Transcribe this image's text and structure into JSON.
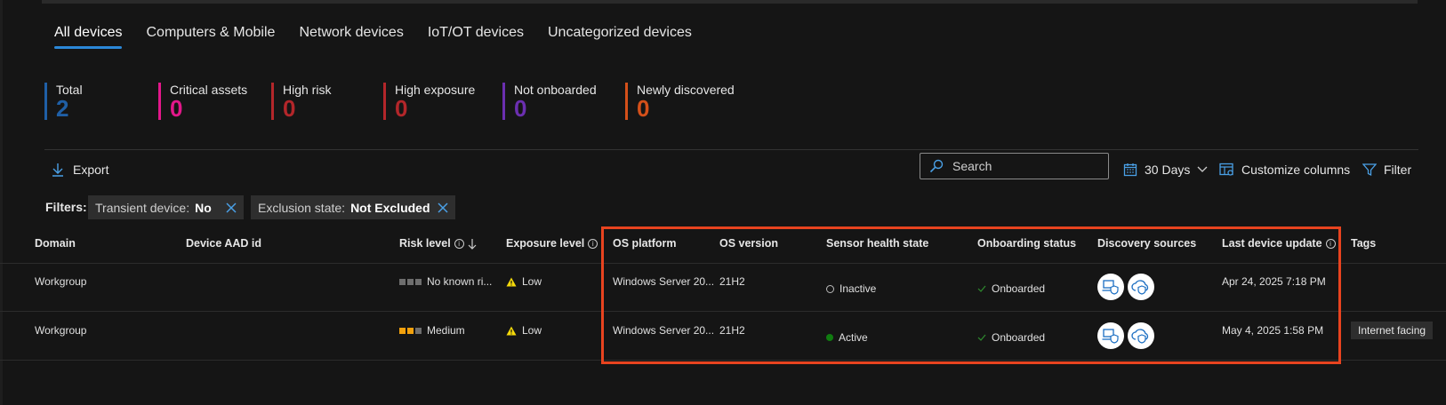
{
  "tabs": [
    "All devices",
    "Computers & Mobile",
    "Network devices",
    "IoT/OT devices",
    "Uncategorized devices"
  ],
  "stats": [
    {
      "label": "Total",
      "value": "2",
      "color": "#1f5fa6"
    },
    {
      "label": "Critical assets",
      "value": "0",
      "color": "#e3178a"
    },
    {
      "label": "High risk",
      "value": "0",
      "color": "#b3262a"
    },
    {
      "label": "High exposure",
      "value": "0",
      "color": "#b3262a"
    },
    {
      "label": "Not onboarded",
      "value": "0",
      "color": "#6b2fb0"
    },
    {
      "label": "Newly discovered",
      "value": "0",
      "color": "#d4501a"
    }
  ],
  "toolbar": {
    "export_label": "Export",
    "search_placeholder": "Search",
    "days_label": "30 Days",
    "customize_label": "Customize columns",
    "filter_label": "Filter"
  },
  "filters": {
    "label": "Filters:",
    "chips": [
      {
        "key": "Transient device:",
        "value": "No"
      },
      {
        "key": "Exclusion state:",
        "value": "Not Excluded"
      }
    ]
  },
  "columns": {
    "domain": "Domain",
    "aad": "Device AAD id",
    "risk": "Risk level",
    "exposure": "Exposure level",
    "os_platform": "OS platform",
    "os_version": "OS version",
    "sensor": "Sensor health state",
    "onboarding": "Onboarding status",
    "discovery": "Discovery sources",
    "last_update": "Last device update",
    "tags": "Tags"
  },
  "rows": [
    {
      "domain": "Workgroup",
      "aad": "",
      "risk": "No known ri...",
      "risk_level": 0,
      "exposure": "Low",
      "os_platform": "Windows Server 20...",
      "os_version": "21H2",
      "sensor": "Inactive",
      "onboarding": "Onboarded",
      "last_update": "Apr 24, 2025 7:18 PM",
      "tag": ""
    },
    {
      "domain": "Workgroup",
      "aad": "",
      "risk": "Medium",
      "risk_level": 2,
      "exposure": "Low",
      "os_platform": "Windows Server 20...",
      "os_version": "21H2",
      "sensor": "Active",
      "onboarding": "Onboarded",
      "last_update": "May 4, 2025 1:58 PM",
      "tag": "Internet facing"
    }
  ],
  "colors": {
    "accent": "#2b88d8",
    "highlight": "#e8431f",
    "risk_medium": "#f2a10d",
    "warning": "#f5d90a",
    "active": "#107c10"
  }
}
